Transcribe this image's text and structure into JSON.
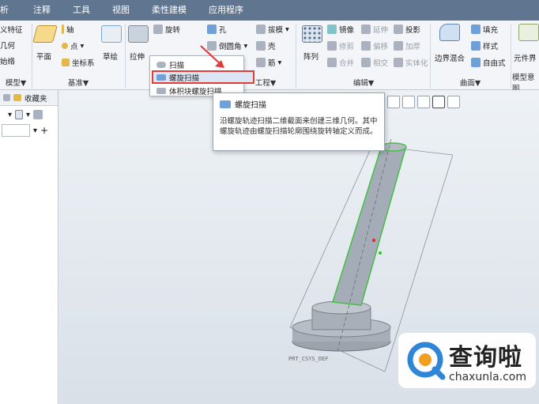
{
  "tabs": [
    "析",
    "注释",
    "工具",
    "视图",
    "柔性建模",
    "应用程序"
  ],
  "ribbon": {
    "col1": [
      "义特征",
      "几何",
      "始络"
    ],
    "plane": "平面",
    "axis": "轴",
    "point": "点",
    "coord": "坐标系",
    "sketch": "草绘",
    "extrude": "拉伸",
    "revolve": "旋转",
    "sweep": "扫描",
    "hole": "孔",
    "round": "倒圆角",
    "draft": "拔模",
    "shell": "壳",
    "rib": "筋",
    "pattern": "阵列",
    "mirror": "镜像",
    "extend": "延伸",
    "project": "投影",
    "trim": "修剪",
    "offset": "偏移",
    "thicken": "加厚",
    "merge": "合并",
    "intersect": "相交",
    "solidify": "实体化",
    "boundary": "边界混合",
    "fill": "填充",
    "style": "样式",
    "freestyle": "自由式",
    "component": "元件界",
    "groups": {
      "g1": "模型▼",
      "datum": "基准▼",
      "shapes": "工程▼",
      "edit": "编辑▼",
      "surface": "曲面▼",
      "intent": "模型意图"
    }
  },
  "dropdown": {
    "items": [
      "扫描",
      "螺旋扫描",
      "体积块螺旋扫描"
    ]
  },
  "tooltip": {
    "title": "螺旋扫描",
    "body": "沿螺旋轨迹扫描二维截面来创建三维几何。其中螺旋轨迹由螺旋扫描轮廓围绕旋转轴定义而成。"
  },
  "leftpanel": {
    "tab": "收藏夹"
  },
  "canvas": {
    "csys_label": "PRT_CSYS_DEF"
  },
  "watermark": {
    "cn": "查询啦",
    "en": "chaxunla.com"
  },
  "colors": {
    "tabbar": "#5f7590",
    "highlight": "#e23b3b",
    "model": "#a6adb8",
    "edge_green": "#43c043"
  }
}
